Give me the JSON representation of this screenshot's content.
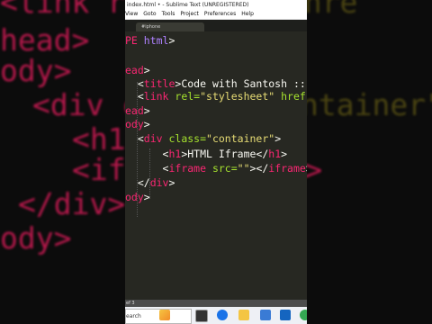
{
  "window": {
    "title": "index.html • - Sublime Text (UNREGISTERED)"
  },
  "menu": [
    "View",
    "Goto",
    "Tools",
    "Project",
    "Preferences",
    "Help"
  ],
  "tab": {
    "label": "#iphone"
  },
  "code": [
    [
      {
        "t": "PE ",
        "c": "t"
      },
      {
        "t": "html",
        "c": "k"
      },
      {
        "t": ">",
        "c": "w"
      }
    ],
    [],
    [
      {
        "t": "ead",
        "c": "t"
      },
      {
        "t": ">",
        "c": "w"
      }
    ],
    [
      {
        "t": "  <",
        "c": "w"
      },
      {
        "t": "title",
        "c": "t"
      },
      {
        "t": ">Code with Santosh ::",
        "c": "w"
      }
    ],
    [
      {
        "t": "  <",
        "c": "w"
      },
      {
        "t": "link",
        "c": "t"
      },
      {
        "t": " rel=",
        "c": "a"
      },
      {
        "t": "\"stylesheet\"",
        "c": "s"
      },
      {
        "t": " href",
        "c": "a"
      }
    ],
    [
      {
        "t": "ead",
        "c": "t"
      },
      {
        "t": ">",
        "c": "w"
      }
    ],
    [
      {
        "t": "ody",
        "c": "t"
      },
      {
        "t": ">",
        "c": "w"
      }
    ],
    [
      {
        "t": "  <",
        "c": "w"
      },
      {
        "t": "div",
        "c": "t"
      },
      {
        "t": " class=",
        "c": "a"
      },
      {
        "t": "\"container\"",
        "c": "s"
      },
      {
        "t": ">",
        "c": "w"
      }
    ],
    [
      {
        "t": "      <",
        "c": "w"
      },
      {
        "t": "h1",
        "c": "t"
      },
      {
        "t": ">HTML Iframe</",
        "c": "w"
      },
      {
        "t": "h1",
        "c": "t"
      },
      {
        "t": ">",
        "c": "w"
      }
    ],
    [
      {
        "t": "      <",
        "c": "w"
      },
      {
        "t": "iframe",
        "c": "t"
      },
      {
        "t": " src=",
        "c": "a"
      },
      {
        "t": "\"\"",
        "c": "s"
      },
      {
        "t": "></",
        "c": "w"
      },
      {
        "t": "iframe",
        "c": "t"
      },
      {
        "t": ">",
        "c": "w"
      }
    ],
    [
      {
        "t": "  </",
        "c": "w"
      },
      {
        "t": "div",
        "c": "t"
      },
      {
        "t": ">",
        "c": "w"
      }
    ],
    [
      {
        "t": "ody",
        "c": "t"
      },
      {
        "t": ">",
        "c": "w"
      }
    ]
  ],
  "status": {
    "text": "ef 3"
  },
  "taskbar": {
    "search_label": "earch"
  },
  "background": [
    [
      {
        "t": "<link r",
        "c": "#b2184a"
      },
      {
        "t": "el=\"",
        "c": "#2f4a10"
      },
      {
        "t": "   eet\" hre",
        "c": "#4a4412"
      }
    ],
    [
      {
        "t": "head>",
        "c": "#b2184a"
      }
    ],
    [],
    [
      {
        "t": "ody>",
        "c": "#b2184a"
      }
    ],
    [
      {
        "t": "<div cl",
        "c": "#b2184a"
      },
      {
        "t": "ass=",
        "c": "#2f4a10"
      },
      {
        "t": "    \"container\">",
        "c": "#4a4412"
      }
    ],
    [
      {
        "t": "   <h1>",
        "c": "#b2184a"
      },
      {
        "t": "               </h1>",
        "c": "#b2184a"
      }
    ],
    [
      {
        "t": "   <ifr",
        "c": "#b2184a"
      },
      {
        "t": "              </iframe>",
        "c": "#b2184a"
      }
    ],
    [
      {
        "t": "</div>",
        "c": "#b2184a"
      }
    ],
    [
      {
        "t": "ody>",
        "c": "#b2184a"
      }
    ]
  ]
}
